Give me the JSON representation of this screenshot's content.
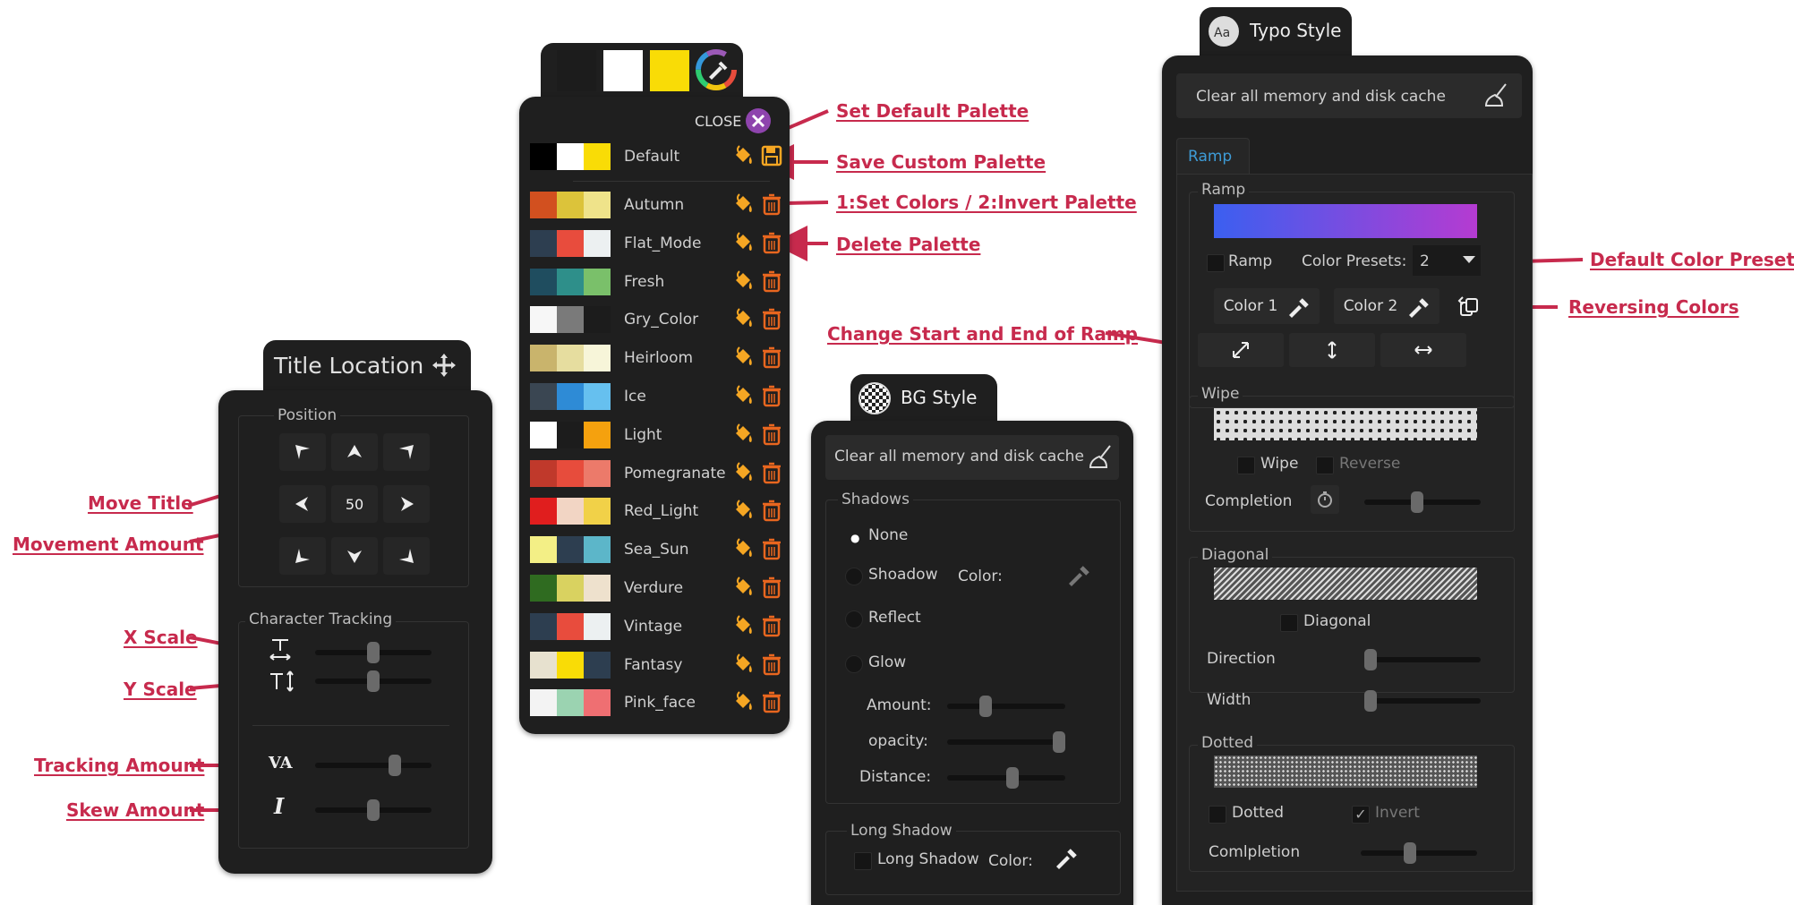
{
  "title_location": {
    "tab_title": "Title Location",
    "position_caption": "Position",
    "movement_amount": "50",
    "tracking_caption": "Character Tracking"
  },
  "palette": {
    "close_label": "CLOSE",
    "top_swatches": [
      "#1c1c1c",
      "#ffffff",
      "#f9dc06"
    ],
    "items": [
      {
        "name": "Default",
        "colors": [
          "#000000",
          "#ffffff",
          "#f9dc06"
        ]
      },
      {
        "name": "Autumn",
        "colors": [
          "#d2501f",
          "#dcc33a",
          "#efe38a"
        ]
      },
      {
        "name": "Flat_Mode",
        "colors": [
          "#2d3e50",
          "#e84c3d",
          "#ecf0f1"
        ]
      },
      {
        "name": "Fresh",
        "colors": [
          "#1f4d5f",
          "#2e8f8a",
          "#7ac06a"
        ]
      },
      {
        "name": "Gry_Color",
        "colors": [
          "#f7f7f7",
          "#7a7a7a",
          "#1c1c1c"
        ]
      },
      {
        "name": "Heirloom",
        "colors": [
          "#c9b46c",
          "#e6dd9f",
          "#f7f5d9"
        ]
      },
      {
        "name": "Ice",
        "colors": [
          "#3a4652",
          "#2e8bd6",
          "#66c0ef"
        ]
      },
      {
        "name": "Light",
        "colors": [
          "#ffffff",
          "#1c1c1c",
          "#f5a10e"
        ]
      },
      {
        "name": "Pomegranate",
        "colors": [
          "#c0392b",
          "#e74c3c",
          "#ec7a6a"
        ]
      },
      {
        "name": "Red_Light",
        "colors": [
          "#e01e1e",
          "#f2d5c4",
          "#f1d148"
        ]
      },
      {
        "name": "Sea_Sun",
        "colors": [
          "#f3ef86",
          "#2d3e50",
          "#5cb6c9"
        ]
      },
      {
        "name": "Verdure",
        "colors": [
          "#2f6b20",
          "#d9d260",
          "#eee1cd"
        ]
      },
      {
        "name": "Vintage",
        "colors": [
          "#2d3e50",
          "#e84c3d",
          "#ecf0f1"
        ]
      },
      {
        "name": "Fantasy",
        "colors": [
          "#e7e1cf",
          "#f9dc06",
          "#2d3e50"
        ]
      },
      {
        "name": "Pink_face",
        "colors": [
          "#f3f3f3",
          "#9bd3b1",
          "#ef6f72"
        ]
      }
    ]
  },
  "bg_style": {
    "tab_title": "BG Style",
    "cache_label": "Clear all memory and disk cache",
    "shadows_caption": "Shadows",
    "none_label": "None",
    "shoadow_label": "Shoadow",
    "color_label": "Color:",
    "reflect_label": "Reflect",
    "glow_label": "Glow",
    "amount_label": "Amount:",
    "opacity_label": "opacity:",
    "distance_label": "Distance:",
    "long_shadow_caption": "Long Shadow",
    "long_shadow_label": "Long Shadow",
    "long_color_label": "Color:"
  },
  "typo_style": {
    "tab_title": "Typo Style",
    "cache_label": "Clear all memory and disk cache",
    "ramp_tab": "Ramp",
    "ramp_caption": "Ramp",
    "ramp_label": "Ramp",
    "color_presets_label": "Color Presets:",
    "color_presets_value": "2",
    "color1_label": "Color 1",
    "color2_label": "Color 2",
    "wipe_caption": "Wipe",
    "wipe_label": "Wipe",
    "reverse_label": "Reverse",
    "completion_label": "Completion",
    "diagonal_caption": "Diagonal",
    "diagonal_label": "Diagonal",
    "direction_label": "Direction",
    "width_label": "Width",
    "dotted_caption": "Dotted",
    "dotted_label": "Dotted",
    "invert_label": "Invert",
    "comlpletion_label": "Comlpletion",
    "ramp_gradient": [
      "#3b5ff0",
      "#b53bd1"
    ]
  },
  "annotations": {
    "move_title": "Move Title",
    "movement_amount": "Movement Amount",
    "x_scale": "X Scale",
    "y_scale": "Y Scale",
    "tracking_amount": "Tracking Amount",
    "skew_amount": "Skew Amount",
    "set_default_palette": "Set Default Palette",
    "save_custom_palette": "Save Custom Palette",
    "set_colors_invert": "1:Set Colors /  2:Invert Palette",
    "delete_palette": "Delete Palette",
    "change_ramp": "Change Start and End of Ramp",
    "default_color_presets": "Default Color Presets",
    "reversing_colors": "Reversing Colors"
  },
  "accent_colors": {
    "annotation": "#c72a4d",
    "panel": "#1f1f1f",
    "icon_orange": "#f5a623",
    "close_badge": "#8e44ad"
  }
}
